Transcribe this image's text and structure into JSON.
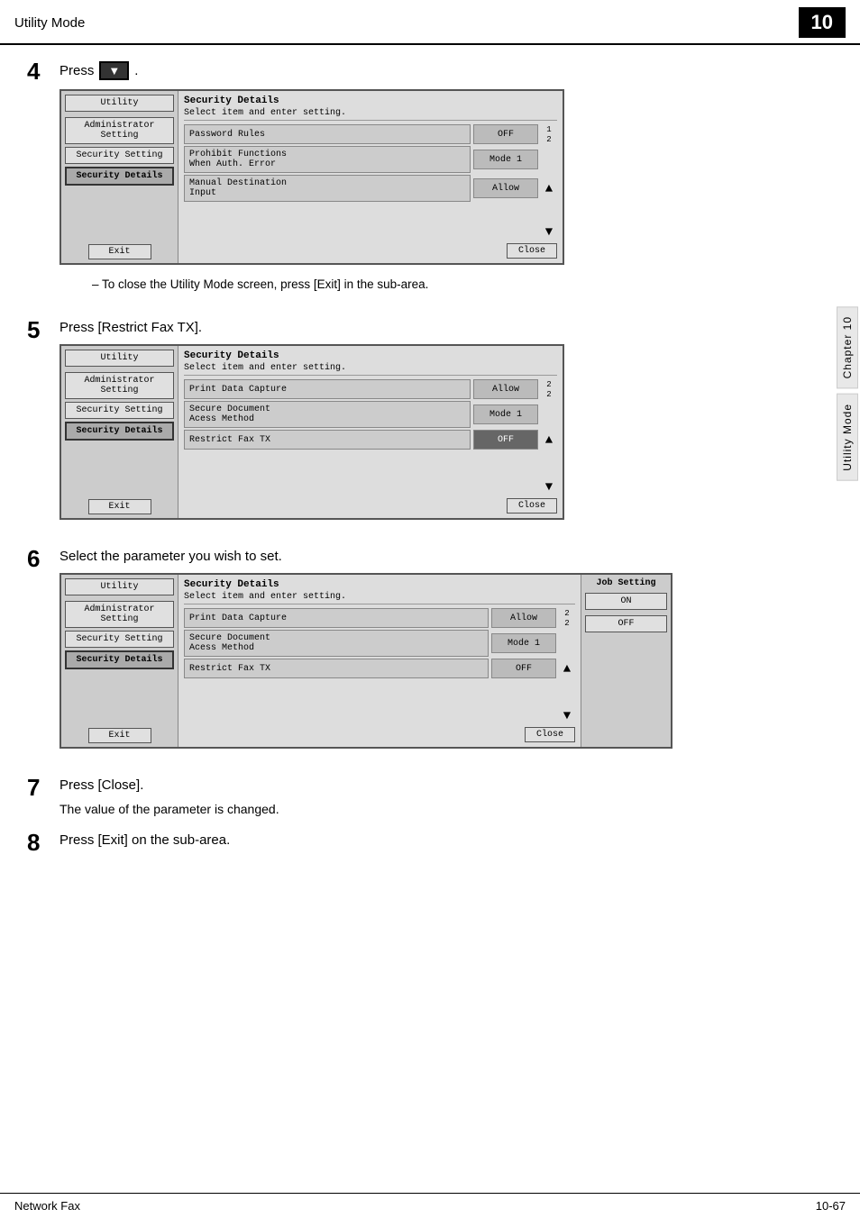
{
  "header": {
    "title": "Utility Mode",
    "chapter_number": "10"
  },
  "chapter_sidebar": {
    "chapter_label": "Chapter 10",
    "mode_label": "Utility Mode"
  },
  "steps": [
    {
      "number": "4",
      "instruction": "Press",
      "has_icon": true,
      "sub_note": "To close the Utility Mode screen, press [Exit] in the sub-area.",
      "screen": {
        "sidebar_buttons": [
          "Utility",
          "Administrator\nSetting",
          "Security Setting",
          "Security Details"
        ],
        "active_button": "Security Details",
        "title": "Security Details",
        "subtitle": "Select item and enter setting.",
        "rows": [
          {
            "label": "Password Rules",
            "value": "OFF"
          },
          {
            "label": "Prohibit Functions\nWhen Auth. Error",
            "value": "Mode 1"
          },
          {
            "label": "Manual Destination\nInput",
            "value": "Allow"
          }
        ],
        "scroll_nums": [
          "1",
          "2"
        ],
        "show_up_arrow": true,
        "show_down_arrow": true,
        "exit_label": "Exit",
        "close_label": "Close"
      }
    },
    {
      "number": "5",
      "instruction": "Press [Restrict Fax TX].",
      "screen": {
        "sidebar_buttons": [
          "Utility",
          "Administrator\nSetting",
          "Security Setting",
          "Security Details"
        ],
        "active_button": "Security Details",
        "title": "Security Details",
        "subtitle": "Select item and enter setting.",
        "rows": [
          {
            "label": "Print Data Capture",
            "value": "Allow"
          },
          {
            "label": "Secure Document\nAcess Method",
            "value": "Mode 1"
          },
          {
            "label": "Restrict Fax TX",
            "value": "OFF",
            "highlighted": true
          }
        ],
        "scroll_nums": [
          "2",
          "2"
        ],
        "show_up_arrow": true,
        "show_down_arrow": true,
        "exit_label": "Exit",
        "close_label": "Close"
      }
    },
    {
      "number": "6",
      "instruction": "Select the parameter you wish to set.",
      "screen": {
        "sidebar_buttons": [
          "Utility",
          "Administrator\nSetting",
          "Security Setting",
          "Security Details"
        ],
        "active_button": "Security Details",
        "title": "Security Details",
        "subtitle": "Select item and enter setting.",
        "rows": [
          {
            "label": "Print Data Capture",
            "value": "Allow"
          },
          {
            "label": "Secure Document\nAcess Method",
            "value": "Mode 1"
          },
          {
            "label": "Restrict Fax TX",
            "value": "OFF"
          }
        ],
        "scroll_nums": [
          "2",
          "2"
        ],
        "show_up_arrow": true,
        "show_down_arrow": true,
        "exit_label": "Exit",
        "close_label": "Close",
        "job_setting": {
          "title": "Job Setting",
          "buttons": [
            "ON",
            "OFF"
          ]
        }
      }
    }
  ],
  "step7": {
    "number": "7",
    "instruction": "Press [Close].",
    "sub_note": "The value of the parameter is changed."
  },
  "step8": {
    "number": "8",
    "instruction": "Press [Exit] on the sub-area."
  },
  "footer": {
    "left": "Network Fax",
    "right": "10-67"
  }
}
